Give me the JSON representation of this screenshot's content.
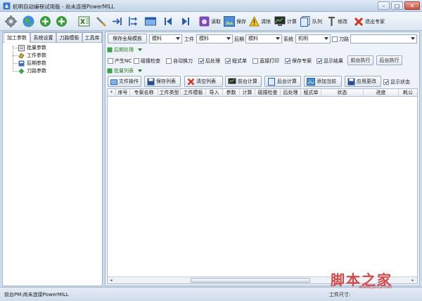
{
  "window": {
    "title": "机明自动编程试用版 - 尚未连接PowerMILL"
  },
  "toolbar": {
    "read_label": "读取",
    "save_label": "保存",
    "clear_label": "清除",
    "compute_label": "计算",
    "queue_label": "队列",
    "modify_label": "修改",
    "exit_label": "退出专家"
  },
  "left_tabs": [
    "加工参数",
    "系统设置",
    "刀路模板",
    "工具库"
  ],
  "tree": [
    "批量参数",
    "工件参数",
    "后期参数",
    "刀路参数"
  ],
  "params": {
    "save_template_button": "保存全局模板",
    "template_combo": "模料",
    "workpiece_label": "工件",
    "workpiece_combo": "模料",
    "post_label": "后期",
    "post_combo": "模料",
    "system_label": "系统",
    "system_combo": "机明",
    "toolpath_label": "刀路"
  },
  "post_section": {
    "title": "后期处理",
    "options": [
      {
        "label": "产生NC",
        "checked": false
      },
      {
        "label": "碰撞检查",
        "checked": false
      },
      {
        "label": "自动换刀",
        "checked": false
      },
      {
        "label": "后处理",
        "checked": true
      },
      {
        "label": "程式单",
        "checked": true
      },
      {
        "label": "直接打印",
        "checked": false
      },
      {
        "label": "保存专案",
        "checked": true
      },
      {
        "label": "显示结果",
        "checked": true
      }
    ],
    "fg_run_button": "前台执行",
    "bg_run_button": "后台执行"
  },
  "batch_section": {
    "title": "批量列表",
    "file_ops_button": "文件操作",
    "save_list_button": "保存列表",
    "clear_list_button": "清空列表",
    "fg_compute_button": "前台计算",
    "bg_compute_button": "后台计算",
    "add_current_button": "添加当前",
    "apply_changes_button": "应用更改",
    "show_status_label": "显示状态",
    "show_status_checked": true
  },
  "grid": {
    "columns": [
      "*",
      "序号",
      "专案名称",
      "工件类型",
      "工件模板",
      "导入",
      "参数",
      "计算",
      "碰撞检查",
      "后处理",
      "程式单",
      "状态",
      "进度",
      "耗公"
    ]
  },
  "status": {
    "left": "前台PM:尚未连接PowerMILL",
    "right": "工件尺寸:"
  },
  "watermark": {
    "text": "脚本之家",
    "url": "www.jb51.net"
  },
  "colors": {
    "accent": "#2f7a2f",
    "title_bg": "#c2d3e8",
    "panel_border": "#9fb3cc",
    "watermark": "#d24a4a"
  }
}
